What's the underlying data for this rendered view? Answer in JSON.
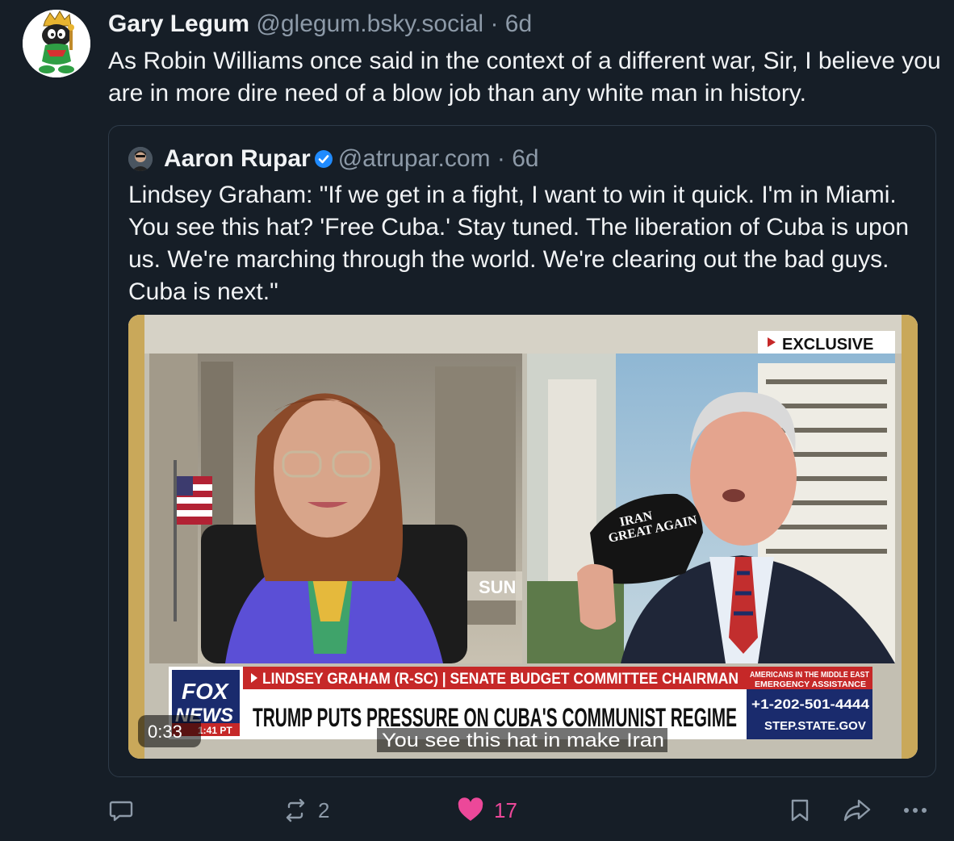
{
  "post": {
    "author": {
      "name": "Gary Legum",
      "handle": "@glegum.bsky.social",
      "separator": "·",
      "time": "6d"
    },
    "text": "As Robin Williams once said in the context of a different war, Sir, I believe you are in more dire need of a blow job than any white man in history."
  },
  "quote": {
    "author": {
      "name": "Aaron Rupar",
      "handle": "@atrupar.com",
      "separator": "·",
      "time": "6d",
      "verified": true
    },
    "text": "Lindsey Graham: \"If we get in a fight, I want to win it quick. I'm in Miami. You see this hat? 'Free Cuba.' Stay tuned. The liberation of Cuba is upon us. We're marching through the world. We're clearing out the bad guys. Cuba is next.\"",
    "video": {
      "exclusive_label": "EXCLUSIVE",
      "network_logo": {
        "line1": "FOX",
        "line2": "NEWS"
      },
      "clock": "1:41 PT",
      "lower_third_top": "LINDSEY GRAHAM (R-SC) | SENATE BUDGET COMMITTEE CHAIRMAN",
      "lower_third_main": "TRUMP PUTS PRESSURE ON CUBA'S COMMUNIST REGIME",
      "side_box": {
        "line1": "AMERICANS IN THE MIDDLE EAST",
        "line2": "EMERGENCY ASSISTANCE",
        "phone": "+1-202-501-4444",
        "site": "STEP.STATE.GOV"
      },
      "hat_text_line1": "IRAN",
      "hat_text_line2": "GREAT AGAIN",
      "building_sign": "SUN",
      "timestamp": "0:33",
      "caption": "You see this hat in make Iran"
    }
  },
  "actions": {
    "reply_icon": "reply-icon",
    "repost_count": "2",
    "like_count": "17",
    "like_color": "#ec4899",
    "bookmark_icon": "bookmark-icon",
    "share_icon": "share-icon",
    "more_icon": "more-icon"
  }
}
